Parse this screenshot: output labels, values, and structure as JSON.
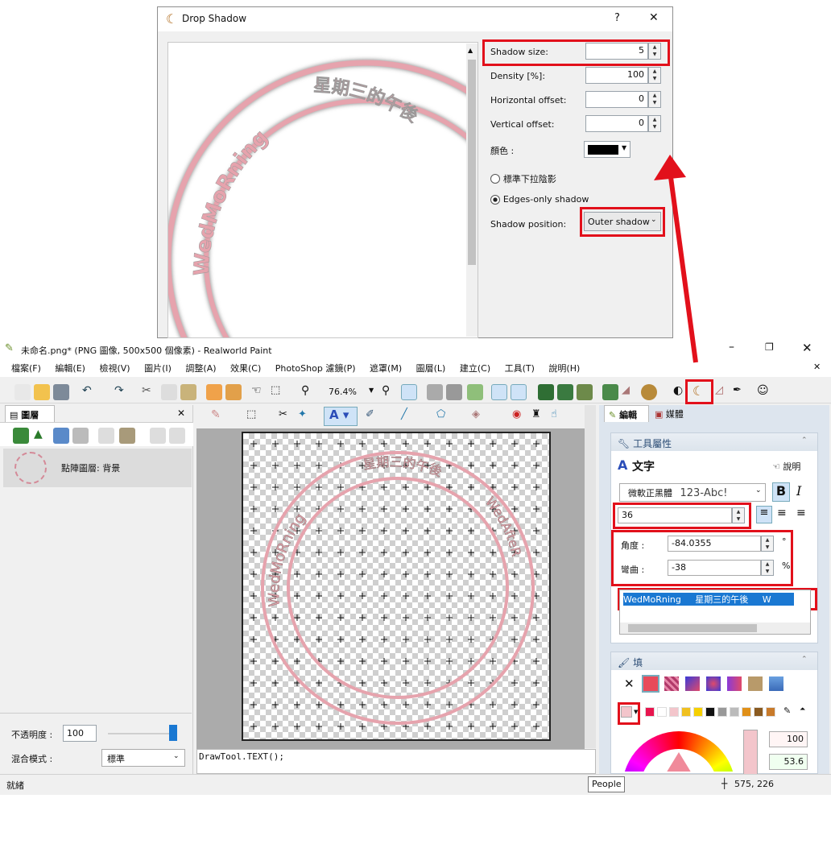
{
  "dialog": {
    "title": "Drop Shadow",
    "help": "?",
    "close": "✕",
    "fields": [
      {
        "label": "Shadow size:",
        "value": "5"
      },
      {
        "label": "Density [%]:",
        "value": "100"
      },
      {
        "label": "Horizontal offset:",
        "value": "0"
      },
      {
        "label": "Vertical offset:",
        "value": "0"
      }
    ],
    "color_label": "顏色 :",
    "color_value": "#000000",
    "radio_standard": "標準下拉陰影",
    "radio_edges": "Edges-only shadow",
    "position_label": "Shadow position:",
    "position_value": "Outer shadow",
    "preview_text_left": "WedMoRning",
    "preview_text_top": "星期三的午後"
  },
  "app": {
    "title": "未命名.png* (PNG 圖像, 500x500 個像素) - Realworld Paint",
    "menu": [
      "檔案(F)",
      "編輯(E)",
      "檢視(V)",
      "圖片(I)",
      "調整(A)",
      "效果(C)",
      "PhotoShop 濾鏡(P)",
      "遮罩(M)",
      "圖層(L)",
      "建立(C)",
      "工具(T)",
      "說明(H)"
    ],
    "zoom": "76.4%"
  },
  "layers": {
    "tab": "圖層",
    "item": "點陣圖層: 背景",
    "opacity_label": "不透明度 :",
    "opacity_value": "100",
    "blend_label": "混合模式 :",
    "blend_value": "標準"
  },
  "canvas": {
    "text_left": "WedMoRning",
    "text_top": "星期三的午後",
    "text_right": "WedAfteR"
  },
  "script_line": "DrawTool.TEXT();",
  "right": {
    "tab_edit": "編輯",
    "tab_media": "媒體",
    "tool_props": "工具屬性",
    "tool_name": "文字",
    "help": "說明",
    "font": "微軟正黑體",
    "font_preview": "123-Abc!",
    "size": "36",
    "angle_label": "角度 :",
    "angle_value": "-84.0355",
    "angle_unit": "°",
    "bend_label": "彎曲 :",
    "bend_value": "-38",
    "bend_unit": "%",
    "text_value": "WedMoRning     星期三的午後     W",
    "fill": "填",
    "fill_value1": "100",
    "fill_value2": "53.6"
  },
  "tooltip": "People",
  "status": {
    "left": "就緒",
    "coords": "575, 226"
  },
  "colors": {
    "accent": "#e2101b",
    "pink": "#e6a3ad"
  }
}
